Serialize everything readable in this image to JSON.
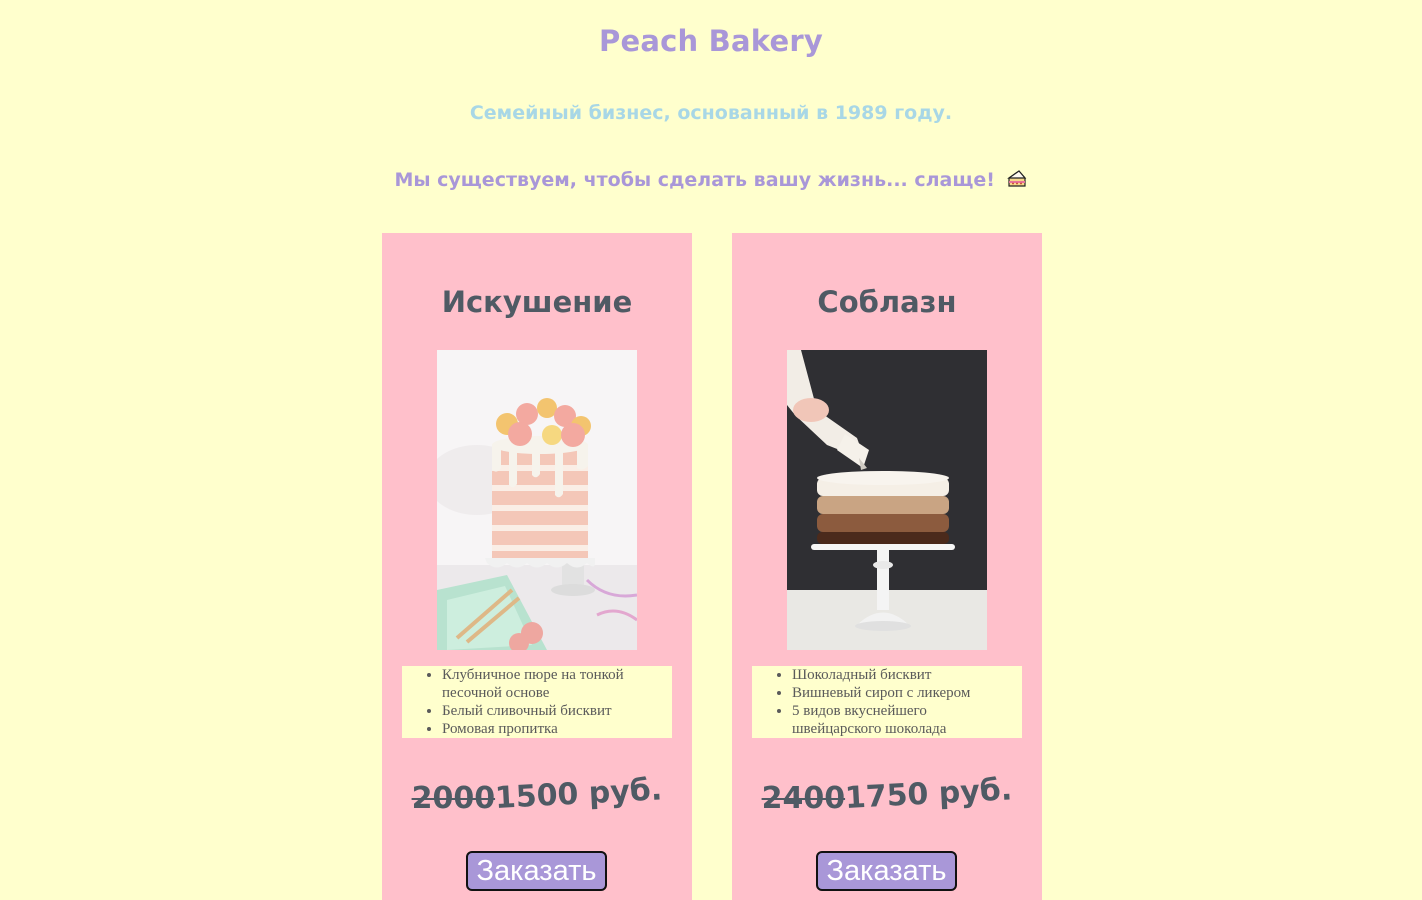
{
  "header": {
    "title": "Peach Bakery",
    "tagline": "Семейный бизнес, основанный в 1989 году.",
    "mission": "Мы существуем, чтобы сделать вашу жизнь... слаще!"
  },
  "colors": {
    "background": "#ffffcd",
    "accent": "#a997d8",
    "tagline": "#a8d7e6",
    "card": "#ffc0cb",
    "text_dark": "#4f5a64"
  },
  "products": [
    {
      "name": "Искушение",
      "image": "drip-cake-with-macarons-photo",
      "ingredients": [
        "Клубничное пюре на тонкой песочной основе",
        "Белый сливочный бисквит",
        "Ромовая пропитка"
      ],
      "old_price": "2000",
      "new_price": "1500 руб.",
      "button_label": "Заказать"
    },
    {
      "name": "Соблазн",
      "image": "chocolate-ombre-cake-photo",
      "ingredients": [
        "Шоколадный бисквит",
        "Вишневый сироп с ликером",
        "5 видов вкуснейшего швейцарского шоколада"
      ],
      "old_price": "2400",
      "new_price": "1750 руб.",
      "button_label": "Заказать"
    }
  ]
}
